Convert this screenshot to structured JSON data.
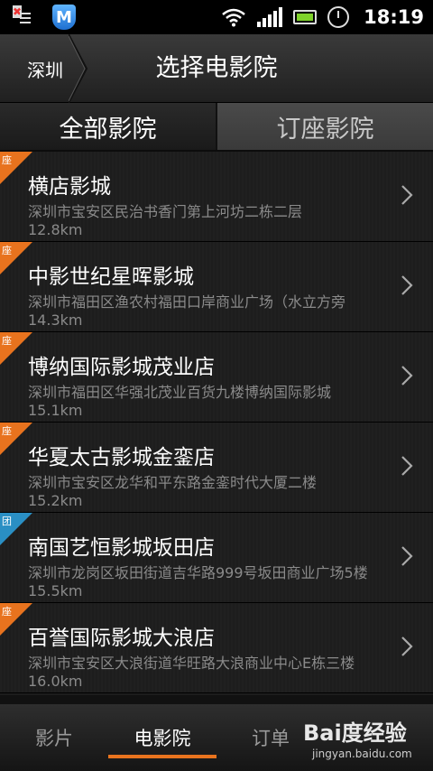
{
  "status_bar": {
    "time": "18:19"
  },
  "header": {
    "city": "深圳",
    "title": "选择电影院"
  },
  "tabs": [
    {
      "label": "全部影院",
      "active": true
    },
    {
      "label": "订座影院",
      "active": false
    }
  ],
  "cinemas": [
    {
      "badge": "座",
      "badge_color": "#e8731e",
      "name": "横店影城",
      "address": "深圳市宝安区民治书香门第上河坊二栋二层",
      "distance": "12.8km"
    },
    {
      "badge": "座",
      "badge_color": "#e8731e",
      "name": "中影世纪星晖影城",
      "address": "深圳市福田区渔农村福田口岸商业广场（水立方旁",
      "distance": "14.3km"
    },
    {
      "badge": "座",
      "badge_color": "#e8731e",
      "name": "博纳国际影城茂业店",
      "address": "深圳市福田区华强北茂业百货九楼博纳国际影城",
      "distance": "15.1km"
    },
    {
      "badge": "座",
      "badge_color": "#e8731e",
      "name": "华夏太古影城金銮店",
      "address": "深圳市宝安区龙华和平东路金銮时代大厦二楼",
      "distance": "15.2km"
    },
    {
      "badge": "团",
      "badge_color": "#2a8fc4",
      "name": "南国艺恒影城坂田店",
      "address": "深圳市龙岗区坂田街道吉华路999号坂田商业广场5楼",
      "distance": "15.5km"
    },
    {
      "badge": "座",
      "badge_color": "#e8731e",
      "name": "百誉国际影城大浪店",
      "address": "深圳市宝安区大浪街道华旺路大浪商业中心E栋三楼",
      "distance": "16.0km"
    }
  ],
  "bottom_nav": [
    {
      "label": "影片",
      "active": false
    },
    {
      "label": "电影院",
      "active": true
    },
    {
      "label": "订单",
      "active": false
    }
  ],
  "watermark": {
    "logo": "Bai度经验",
    "url": "jingyan.baidu.com"
  },
  "colors": {
    "accent": "#e8731e",
    "group_badge": "#2a8fc4"
  }
}
